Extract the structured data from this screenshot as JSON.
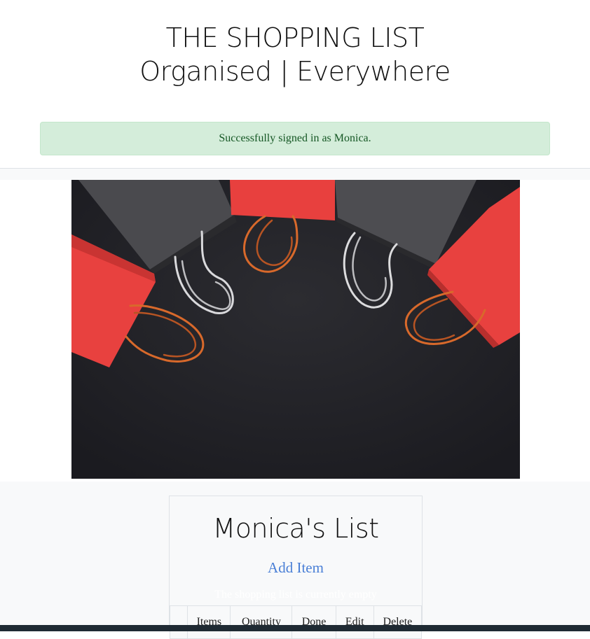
{
  "header": {
    "title": "THE SHOPPING LIST",
    "subtitle": "Organised | Everywhere"
  },
  "alert": {
    "message": "Successfully signed in as Monica.",
    "color": "#d4edda"
  },
  "hero": {
    "image": "shopping-bags-photo"
  },
  "list": {
    "title": "Monica's List",
    "add_item": "Add Item",
    "empty_message": "The shopping list is currently empty",
    "columns": [
      "",
      "Items",
      "Quantity",
      "Done",
      "Edit",
      "Delete"
    ]
  },
  "colors": {
    "accent_link": "#4a7fd6",
    "footer": "#1f2a33",
    "bag_red": "#e8413f",
    "bag_grey": "#4a4a4d"
  }
}
